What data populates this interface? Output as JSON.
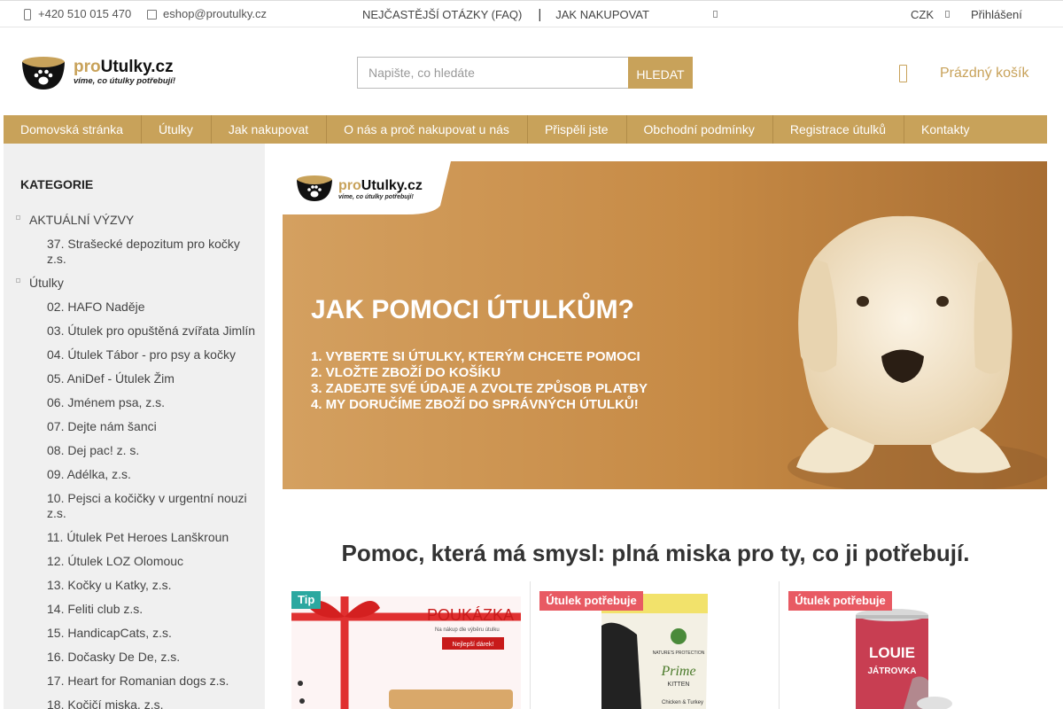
{
  "topbar": {
    "phone": "+420 510 015 470",
    "email": "eshop@proutulky.cz",
    "faq": "NEJČASTĚJŠÍ OTÁZKY (FAQ)",
    "separator": "|",
    "how_to_shop": "JAK NAKUPOVAT",
    "currency": "CZK",
    "login": "Přihlášení"
  },
  "logo": {
    "brand_pro": "pro",
    "brand_rest": "Utulky.cz",
    "tagline": "víme, co útulky potřebují!"
  },
  "search": {
    "placeholder": "Napište, co hledáte",
    "button": "HLEDAT"
  },
  "cart": {
    "label": "Prázdný košík"
  },
  "nav": [
    "Domovská stránka",
    "Útulky",
    "Jak nakupovat",
    "O nás a proč nakupovat u nás",
    "Přispěli jste",
    "Obchodní podmínky",
    "Registrace útulků",
    "Kontakty"
  ],
  "sidebar": {
    "heading": "KATEGORIE",
    "categories": [
      {
        "label": "AKTUÁLNÍ VÝZVY",
        "level": "top"
      },
      {
        "label": "37. Strašecké depozitum pro kočky z.s.",
        "level": "sub"
      },
      {
        "label": "Útulky",
        "level": "top"
      },
      {
        "label": "02. HAFO Naděje",
        "level": "sub"
      },
      {
        "label": "03. Útulek pro opuštěná zvířata Jimlín",
        "level": "sub"
      },
      {
        "label": "04. Útulek Tábor - pro psy a kočky",
        "level": "sub"
      },
      {
        "label": "05. AniDef - Útulek Žim",
        "level": "sub"
      },
      {
        "label": "06. Jménem psa, z.s.",
        "level": "sub"
      },
      {
        "label": "07. Dejte nám šanci",
        "level": "sub"
      },
      {
        "label": "08. Dej pac! z. s.",
        "level": "sub"
      },
      {
        "label": "09. Adélka, z.s.",
        "level": "sub"
      },
      {
        "label": "10. Pejsci a kočičky v urgentní nouzi z.s.",
        "level": "sub"
      },
      {
        "label": "11. Útulek Pet Heroes Lanškroun",
        "level": "sub"
      },
      {
        "label": "12. Útulek LOZ Olomouc",
        "level": "sub"
      },
      {
        "label": "13. Kočky u Katky, z.s.",
        "level": "sub"
      },
      {
        "label": "14. Feliti club z.s.",
        "level": "sub"
      },
      {
        "label": "15. HandicapCats, z.s.",
        "level": "sub"
      },
      {
        "label": "16. Dočasky De De, z.s.",
        "level": "sub"
      },
      {
        "label": "17. Heart for Romanian dogs z.s.",
        "level": "sub"
      },
      {
        "label": "18. Kočičí miska, z.s.",
        "level": "sub"
      }
    ]
  },
  "banner": {
    "headline": "JAK POMOCI ÚTULKŮM?",
    "steps": [
      "1. VYBERTE SI ÚTULKY, KTERÝM CHCETE POMOCI",
      "2. VLOŽTE ZBOŽÍ DO KOŠÍKU",
      "3. ZADEJTE SVÉ ÚDAJE A ZVOLTE ZPŮSOB PLATBY",
      "4. MY DORUČÍME ZBOŽÍ DO SPRÁVNÝCH ÚTULKŮ!"
    ]
  },
  "main_heading": "Pomoc, která má smysl: plná miska pro ty, co ji potřebují.",
  "products": [
    {
      "badge": "Tip",
      "badge_type": "tip",
      "image_text": "POUKÁZKA",
      "image_sub": "Na nákup dle výběru útulku",
      "image_tag": "Nejlepší dárek!"
    },
    {
      "badge": "Útulek potřebuje",
      "badge_type": "need",
      "brand": "NATURE'S PROTECTION",
      "name": "Prime",
      "variant": "KITTEN",
      "flavor": "Chicken & Turkey"
    },
    {
      "badge": "Útulek potřebuje",
      "badge_type": "need",
      "brand": "LOUIE",
      "name": "JÁTROVKA"
    }
  ],
  "colors": {
    "accent": "#c8a25a",
    "tip_badge": "#2ba8a0",
    "need_badge": "#e85a63",
    "sidebar_bg": "#f0f0f0"
  },
  "icons": [
    "phone-icon",
    "mail-icon",
    "cart-icon",
    "chevron-down-icon"
  ]
}
